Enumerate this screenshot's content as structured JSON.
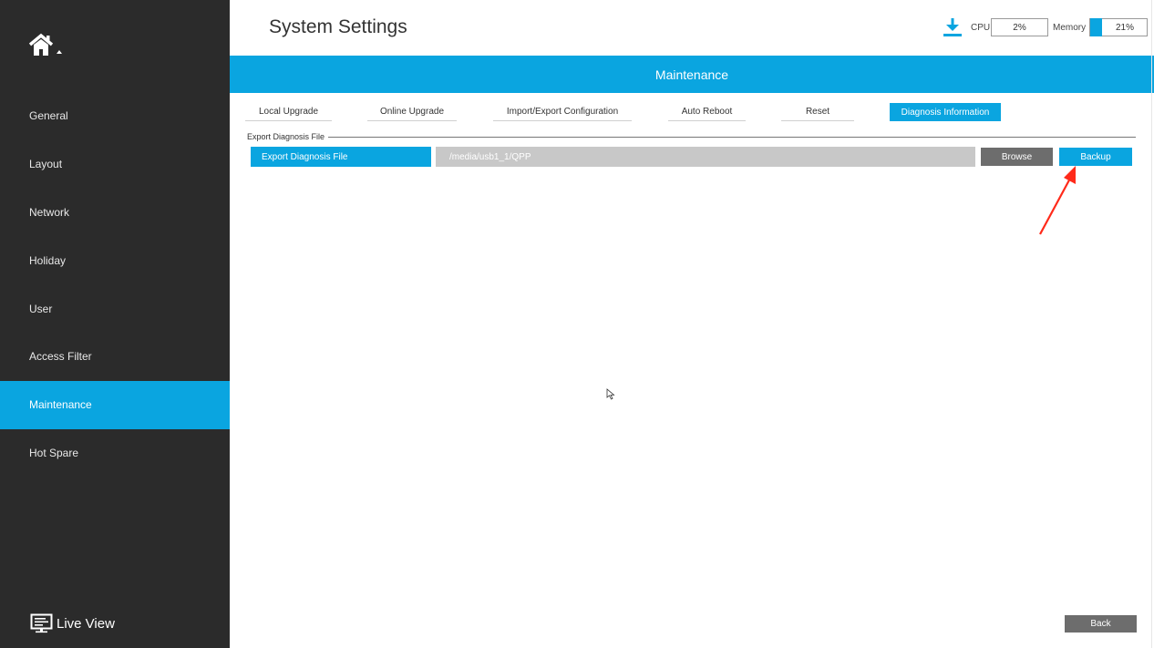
{
  "header": {
    "title": "System Settings",
    "cpu_label": "CPU",
    "cpu_value": "2%",
    "memory_label": "Memory",
    "memory_value": "21%",
    "memory_fraction": 0.21,
    "download_icon": "download-icon"
  },
  "sidebar": {
    "home_icon": "home-icon",
    "items": [
      {
        "label": "General"
      },
      {
        "label": "Layout"
      },
      {
        "label": "Network"
      },
      {
        "label": "Holiday"
      },
      {
        "label": "User"
      },
      {
        "label": "Access Filter"
      },
      {
        "label": "Maintenance",
        "active": true
      },
      {
        "label": "Hot Spare"
      }
    ],
    "live_view_label": "Live View"
  },
  "banner": {
    "title": "Maintenance"
  },
  "tabs": [
    {
      "label": "Local Upgrade"
    },
    {
      "label": "Online Upgrade"
    },
    {
      "label": "Import/Export Configuration"
    },
    {
      "label": "Auto Reboot"
    },
    {
      "label": "Reset"
    },
    {
      "label": "Diagnosis Information",
      "active": true
    }
  ],
  "section": {
    "label": "Export Diagnosis File",
    "export_button": "Export Diagnosis File",
    "path_value": "/media/usb1_1/QPP",
    "browse_label": "Browse",
    "backup_label": "Backup"
  },
  "footer": {
    "back_label": "Back"
  },
  "colors": {
    "accent": "#0aa5e0",
    "sidebar_bg": "#2b2b2b",
    "annotation": "#ff2a1a"
  }
}
